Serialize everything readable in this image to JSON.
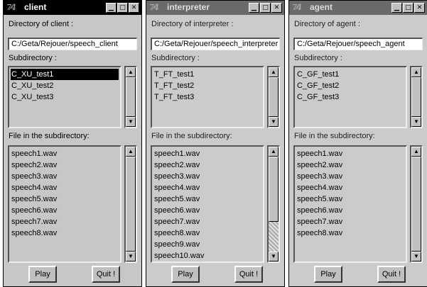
{
  "windows": [
    {
      "title": "client",
      "tk_icon": "7⁄4",
      "window_buttons": [
        "▁",
        "□",
        "✕"
      ],
      "dir_label": "Directory of client :",
      "dir_value": "C:/Geta/Rejouer/speech_client",
      "sub_label": "Subdirectory :",
      "subdirs": [
        "C_XU_test1",
        "C_XU_test2",
        "C_XU_test3"
      ],
      "selected_subdir": "C_XU_test1",
      "file_label": "File in the subdirectory:",
      "files": [
        "speech1.wav",
        "speech2.wav",
        "speech3.wav",
        "speech4.wav",
        "speech5.wav",
        "speech6.wav",
        "speech7.wav",
        "speech8.wav"
      ],
      "play_label": "Play",
      "quit_label": "Quit !"
    },
    {
      "title": "interpreter",
      "tk_icon": "7⁄4",
      "window_buttons": [
        "▁",
        "□",
        "✕"
      ],
      "dir_label": "Directory of interpreter :",
      "dir_value": "C:/Geta/Rejouer/speech_interpreter",
      "sub_label": "Subdirectory :",
      "subdirs": [
        "T_FT_test1",
        "T_FT_test2",
        "T_FT_test3"
      ],
      "file_label": "File in the subdirectory:",
      "files": [
        "speech1.wav",
        "speech2.wav",
        "speech3.wav",
        "speech4.wav",
        "speech5.wav",
        "speech6.wav",
        "speech7.wav",
        "speech8.wav",
        "speech9.wav",
        "speech10.wav"
      ],
      "play_label": "Play",
      "quit_label": "Quit !"
    },
    {
      "title": "agent",
      "tk_icon": "7⁄4",
      "window_buttons": [
        "▁",
        "□",
        "✕"
      ],
      "dir_label": "Directory of agent :",
      "dir_value": "C:/Geta/Rejouer/speech_agent",
      "sub_label": "Subdirectory :",
      "subdirs": [
        "C_GF_test1",
        "C_GF_test2",
        "C_GF_test3"
      ],
      "file_label": "File in the subdirectory:",
      "files": [
        "speech1.wav",
        "speech2.wav",
        "speech3.wav",
        "speech4.wav",
        "speech5.wav",
        "speech6.wav",
        "speech7.wav",
        "speech8.wav"
      ],
      "play_label": "Play",
      "quit_label": "Quit !"
    }
  ],
  "arrows": {
    "up": "▲",
    "down": "▼"
  },
  "colors": {
    "active_titlebar": "#000000",
    "inactive_titlebar": "#6a6a6a",
    "window_bg": "#c7c7c7",
    "selection": "#000000"
  }
}
